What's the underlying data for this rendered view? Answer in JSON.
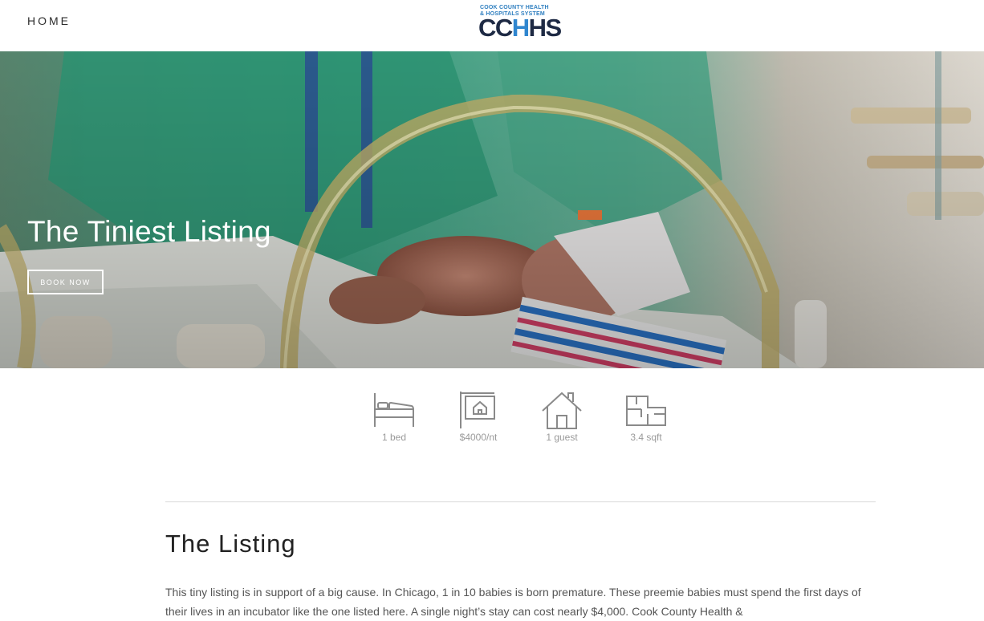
{
  "nav": {
    "home_label": "HOME"
  },
  "logo": {
    "line1": "COOK COUNTY HEALTH",
    "line2": "& HOSPITALS SYSTEM",
    "main_left": "CC",
    "main_accent": "H",
    "main_right": "HS",
    "colors": {
      "accent": "#2f86cf",
      "dark": "#1e2a44"
    }
  },
  "hero": {
    "title": "The Tiniest Listing",
    "button_label": "BOOK NOW",
    "image_description_icon": "incubator-photo"
  },
  "amenities": [
    {
      "icon": "bed-icon",
      "label": "1 bed"
    },
    {
      "icon": "price-sign-icon",
      "label": "$4000/nt"
    },
    {
      "icon": "house-icon",
      "label": "1 guest"
    },
    {
      "icon": "floorplan-icon",
      "label": "3.4 sqft"
    }
  ],
  "listing": {
    "title": "The Listing",
    "body": "This tiny listing is in support of a big cause. In Chicago, 1 in 10 babies is born premature. These preemie babies must spend the first days of their lives in an incubator like the one listed here. A single night’s stay can cost nearly $4,000. Cook County Health &"
  }
}
